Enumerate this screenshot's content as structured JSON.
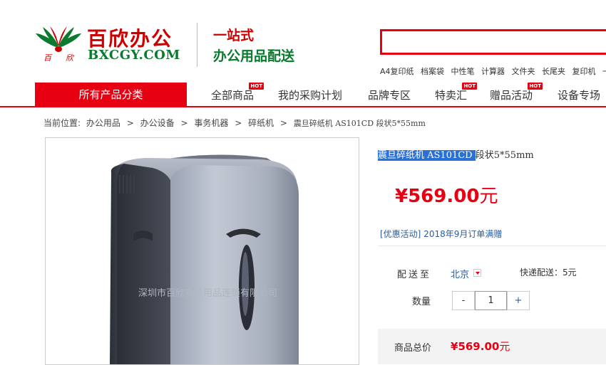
{
  "header": {
    "logo_cn": "百欣办公",
    "logo_en": "BXCGY.COM",
    "slogan_line1": "一站式",
    "slogan_line2": "办公用品配送",
    "search_placeholder": "",
    "hot_words": [
      "A4复印纸",
      "档案袋",
      "中性笔",
      "计算器",
      "文件夹",
      "长尾夹",
      "复印机",
      "一"
    ]
  },
  "nav": {
    "category_button": "所有产品分类",
    "items": [
      {
        "label": "全部商品",
        "hot": "HOT"
      },
      {
        "label": "我的采购计划",
        "hot": ""
      },
      {
        "label": "品牌专区",
        "hot": ""
      },
      {
        "label": "特卖汇",
        "hot": "HOT"
      },
      {
        "label": "赠品活动",
        "hot": "HOT"
      },
      {
        "label": "设备专场",
        "hot": ""
      }
    ]
  },
  "breadcrumb": {
    "prefix": "当前位置:",
    "items": [
      "办公用品",
      "办公设备",
      "事务机器",
      "碎纸机",
      "震旦碎纸机 AS101CD 段状5*55mm"
    ],
    "separator": ">"
  },
  "product": {
    "title_selected": "震旦碎纸机 AS101CD ",
    "title_rest": "段状5*55mm",
    "price_symbol": "¥",
    "price_value": "569.00",
    "price_unit": "元",
    "promo": "[优惠活动] 2018年9月订单满赠",
    "watermark": "深圳市百欣办公用品连锁有限公司"
  },
  "shipping": {
    "label": "配送至",
    "city": "北京",
    "fee": "快递配送：5元"
  },
  "quantity": {
    "label": "数量",
    "minus": "-",
    "value": "1",
    "plus": "+"
  },
  "total": {
    "label": "商品总价",
    "symbol": "¥",
    "value": "569.00",
    "unit": "元"
  },
  "colors": {
    "brand_red": "#e60012",
    "brand_green": "#0a7a2e",
    "link_blue": "#2a5d9f",
    "selection_blue": "#2a71d6"
  }
}
